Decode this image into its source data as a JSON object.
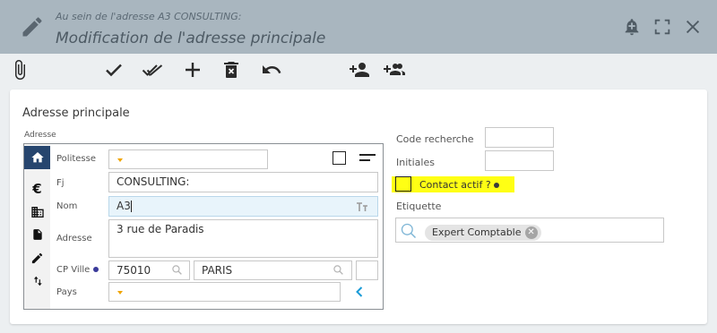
{
  "header": {
    "subtitle": "Au sein de l'adresse A3 CONSULTING:",
    "title": "Modification de l'adresse principale"
  },
  "toolbar": {
    "icons": [
      "paperclip-icon",
      "check-icon",
      "double-check-icon",
      "plus-icon",
      "delete-icon",
      "undo-icon",
      "person-add-icon",
      "group-add-icon"
    ]
  },
  "card": {
    "title": "Adresse principale",
    "group_label": "Adresse",
    "fields": {
      "politesse": {
        "label": "Politesse",
        "value": ""
      },
      "fj": {
        "label": "Fj",
        "value": "CONSULTING:"
      },
      "nom": {
        "label": "Nom",
        "value": "A3"
      },
      "adresse": {
        "label": "Adresse",
        "value": "3 rue de Paradis"
      },
      "cp_ville": {
        "label": "CP Ville",
        "cp": "75010",
        "ville": "PARIS"
      },
      "pays": {
        "label": "Pays",
        "value": ""
      }
    },
    "right": {
      "code_recherche": {
        "label": "Code recherche",
        "value": ""
      },
      "initiales": {
        "label": "Initiales",
        "value": ""
      },
      "contact_actif": {
        "label": "Contact actif ?",
        "checked": false
      },
      "etiquette": {
        "label": "Etiquette",
        "chip": "Expert Comptable"
      }
    }
  },
  "colors": {
    "header_bg": "#a9b6bf",
    "nav_active": "#26456e",
    "highlight": "#ffff14",
    "caret": "#f0a400",
    "link_blue": "#1a9bd7",
    "info_icon": "#3a3a9a"
  }
}
